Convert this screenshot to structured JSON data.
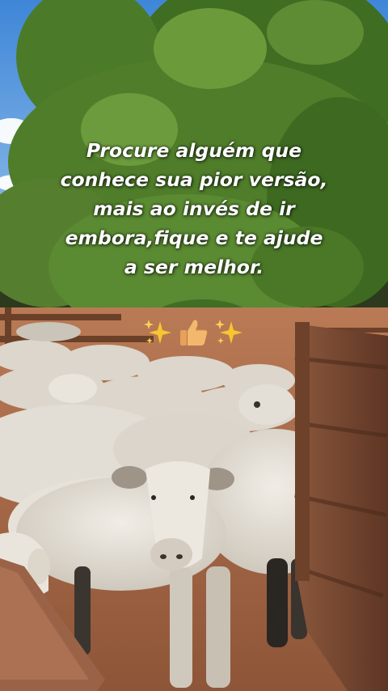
{
  "overlay": {
    "caption_lines": [
      "Procure alguém que",
      "conhece sua pior versão,",
      "mais ao invés de ir",
      "embora,fique e te ajude",
      "a ser melhor."
    ],
    "emojis": [
      "sparkles-icon",
      "thumbs-up-icon",
      "sparkles-icon"
    ]
  },
  "colors": {
    "caption_text": "#ffffff",
    "sky": "#4a90d9",
    "foliage": "#4f7d2a",
    "cattle": "#e6e1d8",
    "fence": "#7a4b33"
  }
}
